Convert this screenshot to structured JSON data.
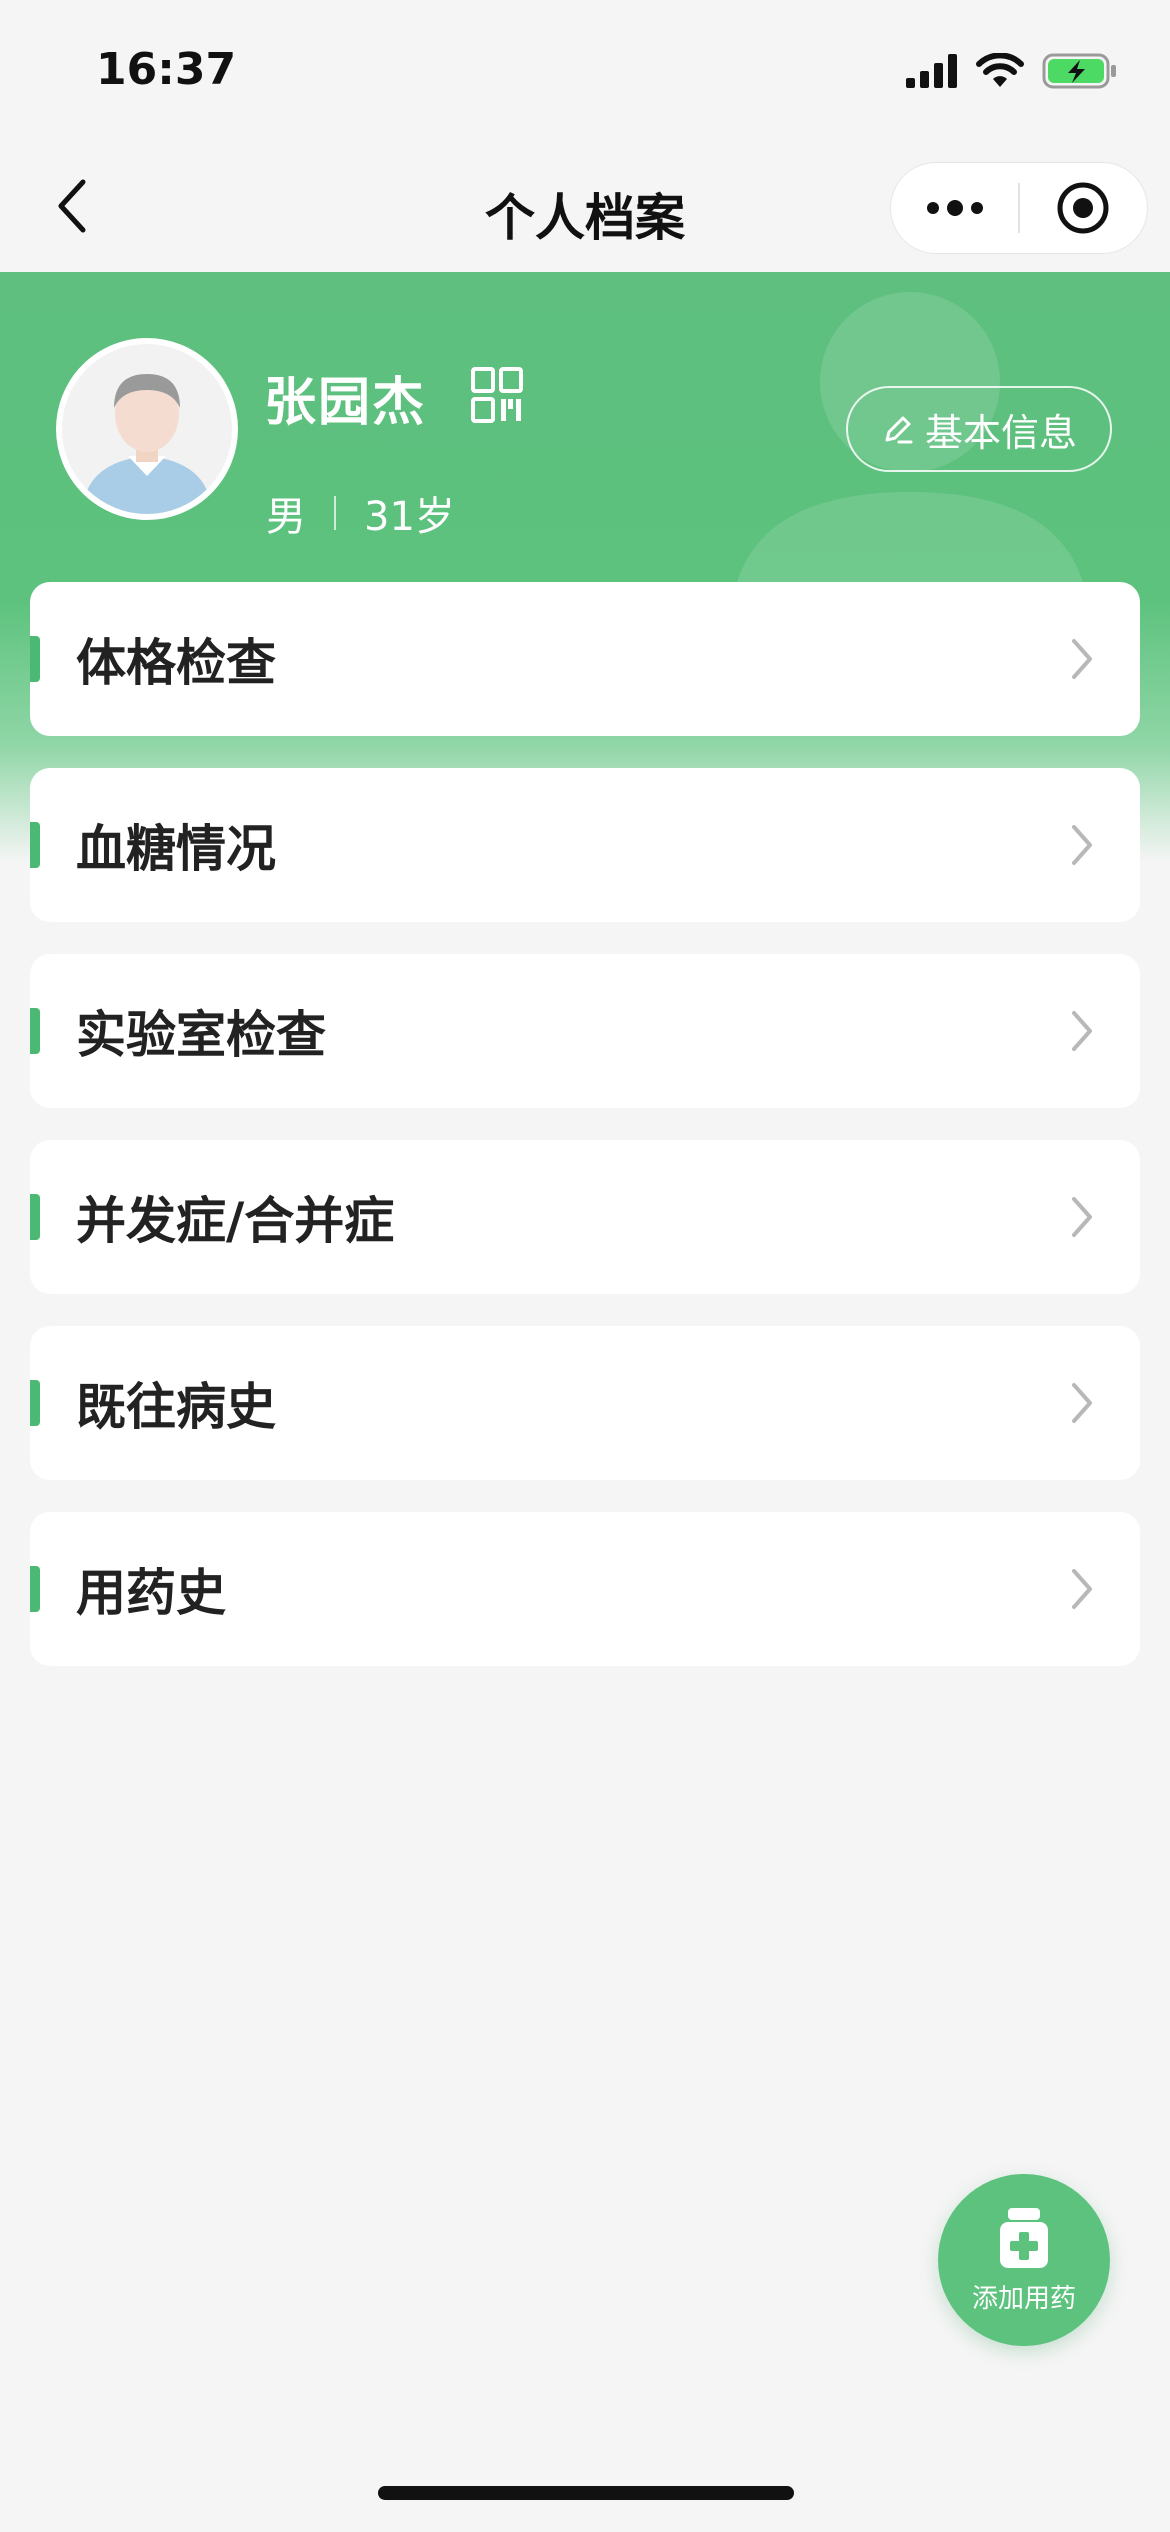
{
  "status_bar": {
    "time": "16:37"
  },
  "nav": {
    "title": "个人档案"
  },
  "profile": {
    "name": "张园杰",
    "gender": "男",
    "age": "31岁",
    "basic_info_label": "基本信息"
  },
  "menu": [
    {
      "label": "体格检查"
    },
    {
      "label": "血糖情况"
    },
    {
      "label": "实验室检查"
    },
    {
      "label": "并发症/合并症"
    },
    {
      "label": "既往病史"
    },
    {
      "label": "用药史"
    }
  ],
  "fab": {
    "label": "添加用药"
  },
  "colors": {
    "accent": "#5cc27d",
    "accent_dark": "#4bb874",
    "background": "#f5f5f5"
  }
}
